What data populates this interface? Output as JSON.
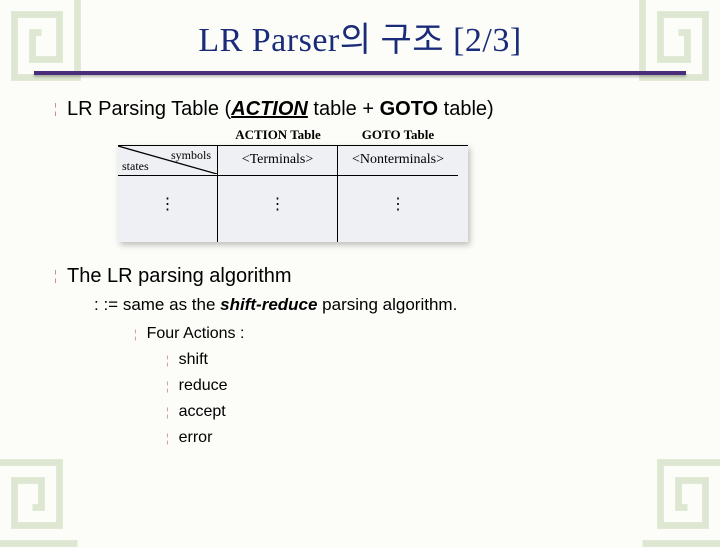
{
  "title": "LR Parser의 구조 [2/3]",
  "bullet1": {
    "prefix": "LR Parsing Table (",
    "action_word": "ACTION",
    "mid1": "  table + ",
    "goto_word": "GOTO",
    "mid2": "  table)"
  },
  "table": {
    "label_action": "ACTION Table",
    "label_goto": "GOTO Table",
    "corner_symbols": "symbols",
    "corner_states": "states",
    "col_action_header": "<Terminals>",
    "col_goto_header": "<Nonterminals>",
    "vdots": "⋮"
  },
  "bullet2": {
    "text": "The LR parsing algorithm"
  },
  "sub1": {
    "prefix": ": := same as the ",
    "emph": "shift-reduce",
    "suffix": "  parsing algorithm."
  },
  "four_actions": {
    "label": "Four Actions :",
    "items": [
      "shift",
      "reduce",
      "accept",
      "error"
    ]
  }
}
